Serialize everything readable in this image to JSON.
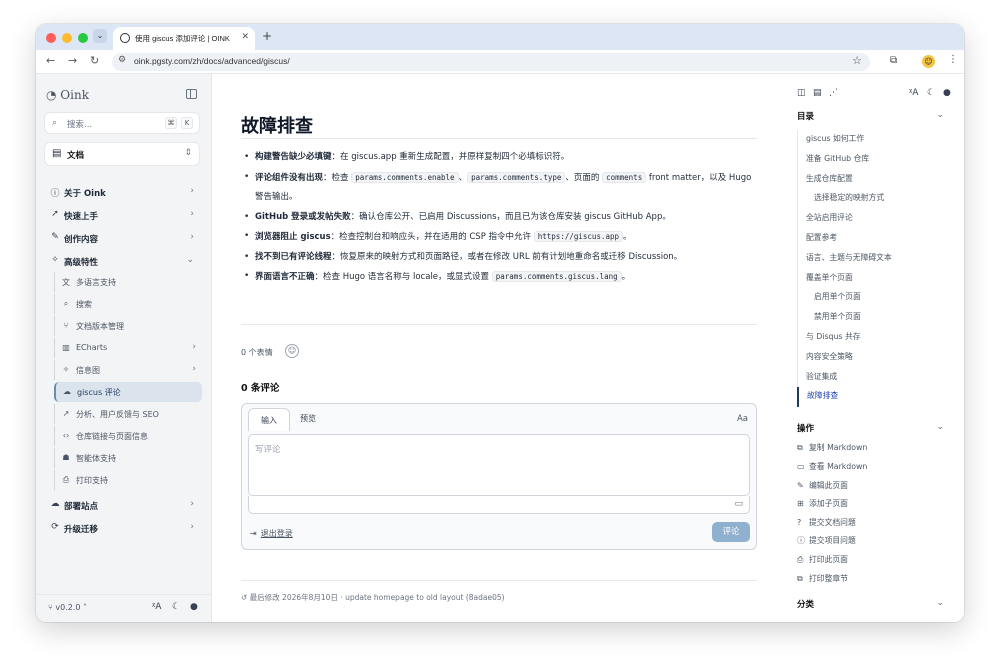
{
  "browser": {
    "tab_title": "使用 giscus 添加评论 | OINK",
    "url": "oink.pgsty.com/zh/docs/advanced/giscus/"
  },
  "sidebar": {
    "logo": "Oink",
    "search_placeholder": "搜索...",
    "search_kbd_1": "⌘",
    "search_kbd_2": "K",
    "doc_select": "文档",
    "items": [
      {
        "label": "关于 Oink",
        "icon": "info-icon"
      },
      {
        "label": "快速上手",
        "icon": "rocket-icon"
      },
      {
        "label": "创作内容",
        "icon": "pencil-ruler-icon"
      },
      {
        "label": "高级特性",
        "icon": "wand-icon"
      }
    ],
    "subitems": [
      {
        "label": "多语言支持",
        "icon": "language-icon"
      },
      {
        "label": "搜索",
        "icon": "search-icon"
      },
      {
        "label": "文档版本管理",
        "icon": "git-branch-icon"
      },
      {
        "label": "ECharts",
        "icon": "chart-icon"
      },
      {
        "label": "信息图",
        "icon": "infographic-icon"
      },
      {
        "label": "giscus 评论",
        "icon": "chat-icon"
      },
      {
        "label": "分析、用户反馈与 SEO",
        "icon": "analytics-icon"
      },
      {
        "label": "仓库链接与页面信息",
        "icon": "code-icon"
      },
      {
        "label": "智能体支持",
        "icon": "bot-icon"
      },
      {
        "label": "打印支持",
        "icon": "printer-icon"
      }
    ],
    "bottom_items": [
      {
        "label": "部署站点",
        "icon": "cloud-upload-icon"
      },
      {
        "label": "升级迁移",
        "icon": "refresh-icon"
      }
    ],
    "version": "v0.2.0"
  },
  "main": {
    "title": "故障排查",
    "bullets": [
      {
        "bold": "构建警告缺少必填键",
        "rest": "：在 giscus.app 重新生成配置，并原样复制四个必填标识符。"
      },
      {
        "bold": "评论组件没有出现",
        "pre": "：检查 ",
        "c1": "params.comments.enable",
        "sep1": "、",
        "c2": "params.comments.type",
        "sep2": "、页面的 ",
        "c3": "comments",
        "post": " front matter，以及 Hugo 警告输出。"
      },
      {
        "bold": "GitHub 登录或发帖失败",
        "rest": "：确认仓库公开、已启用 Discussions，而且已为该仓库安装 giscus GitHub App。"
      },
      {
        "bold": "浏览器阻止 giscus",
        "pre": "：检查控制台和响应头，并在适用的 CSP 指令中允许 ",
        "c1": "https://giscus.app",
        "post": "。"
      },
      {
        "bold": "找不到已有评论线程",
        "rest": "：恢复原来的映射方式和页面路径，或者在修改 URL 前有计划地重命名或迁移 Discussion。"
      },
      {
        "bold": "界面语言不正确",
        "pre": "：检查 Hugo 语言名称与 locale，或显式设置 ",
        "c1": "params.comments.giscus.lang",
        "post": "。"
      }
    ],
    "reactions": "0 个表情",
    "comment_count": "0 条评论",
    "tab_write": "输入",
    "tab_preview": "预览",
    "aa": "Aa",
    "placeholder": "写评论",
    "signout": "退出登录",
    "submit": "评论",
    "last_modified": "最后修改 2026年8月10日 · update homepage to old layout (8adae05)"
  },
  "toc": {
    "heading": "目录",
    "items": [
      {
        "label": "giscus 如何工作",
        "sub": false
      },
      {
        "label": "准备 GitHub 仓库",
        "sub": false
      },
      {
        "label": "生成仓库配置",
        "sub": false
      },
      {
        "label": "选择稳定的映射方式",
        "sub": true
      },
      {
        "label": "全站启用评论",
        "sub": false
      },
      {
        "label": "配置参考",
        "sub": false
      },
      {
        "label": "语言、主题与无障碍文本",
        "sub": false
      },
      {
        "label": "覆盖单个页面",
        "sub": false
      },
      {
        "label": "启用单个页面",
        "sub": true
      },
      {
        "label": "禁用单个页面",
        "sub": true
      },
      {
        "label": "与 Disqus 共存",
        "sub": false
      },
      {
        "label": "内容安全策略",
        "sub": false
      },
      {
        "label": "验证集成",
        "sub": false
      },
      {
        "label": "故障排查",
        "sub": false,
        "active": true
      }
    ],
    "actions_heading": "操作",
    "actions": [
      {
        "label": "复制 Markdown",
        "icon": "copy-icon"
      },
      {
        "label": "查看 Markdown",
        "icon": "markdown-icon"
      },
      {
        "label": "编辑此页面",
        "icon": "edit-icon"
      },
      {
        "label": "添加子页面",
        "icon": "file-plus-icon"
      },
      {
        "label": "提交文档问题",
        "icon": "help-circle-icon"
      },
      {
        "label": "提交项目问题",
        "icon": "alert-circle-icon"
      },
      {
        "label": "打印此页面",
        "icon": "printer-icon"
      },
      {
        "label": "打印整章节",
        "icon": "printer-stack-icon"
      }
    ],
    "category_heading": "分类"
  },
  "colors": {
    "accent": "#1e3a5f",
    "active_bg": "#dbe3ec",
    "submit_bg": "#8fb0cf"
  }
}
